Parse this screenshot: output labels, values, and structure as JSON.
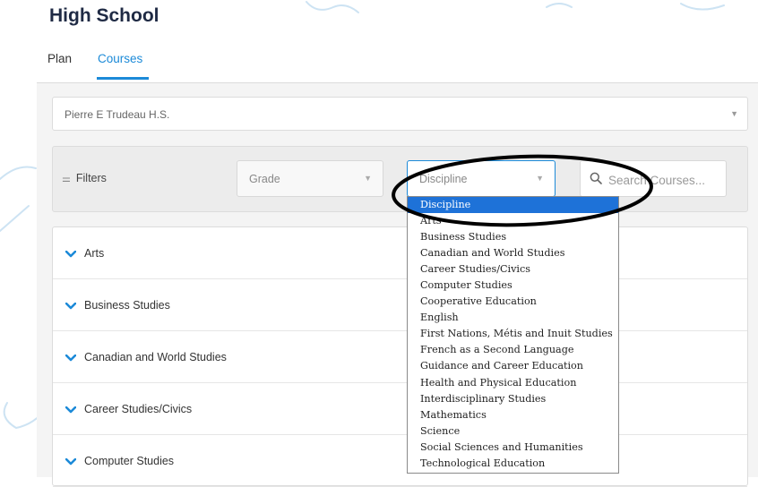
{
  "page": {
    "title": "High School"
  },
  "tabs": [
    {
      "label": "Plan",
      "active": false
    },
    {
      "label": "Courses",
      "active": true
    }
  ],
  "school_select": {
    "value": "Pierre E Trudeau H.S."
  },
  "filters": {
    "label": "Filters",
    "grade_select": {
      "value": "Grade"
    },
    "discipline_select": {
      "value": "Discipline",
      "open": true
    },
    "search": {
      "placeholder": "Search Courses..."
    }
  },
  "course_list": [
    {
      "label": "Arts"
    },
    {
      "label": "Business Studies"
    },
    {
      "label": "Canadian and World Studies"
    },
    {
      "label": "Career Studies/Civics"
    },
    {
      "label": "Computer Studies"
    }
  ],
  "discipline_dropdown": {
    "selected_index": 0,
    "options": [
      "Discipline",
      "Arts",
      "Business Studies",
      "Canadian and World Studies",
      "Career Studies/Civics",
      "Computer Studies",
      "Cooperative Education",
      "English",
      "First Nations, Métis and Inuit Studies",
      "French as a Second Language",
      "Guidance and Career Education",
      "Health and Physical Education",
      "Interdisciplinary Studies",
      "Mathematics",
      "Science",
      "Social Sciences and Humanities",
      "Technological Education"
    ]
  },
  "icons": {
    "filter": "filter-sliders-icon",
    "search": "search-icon",
    "expand": "chevron-down-icon",
    "select_arrow": "caret-down-icon"
  },
  "colors": {
    "accent": "#1c8ad8",
    "title": "#1f2a44",
    "dropdown_highlight": "#1e72d8",
    "annotation": "#000000"
  }
}
